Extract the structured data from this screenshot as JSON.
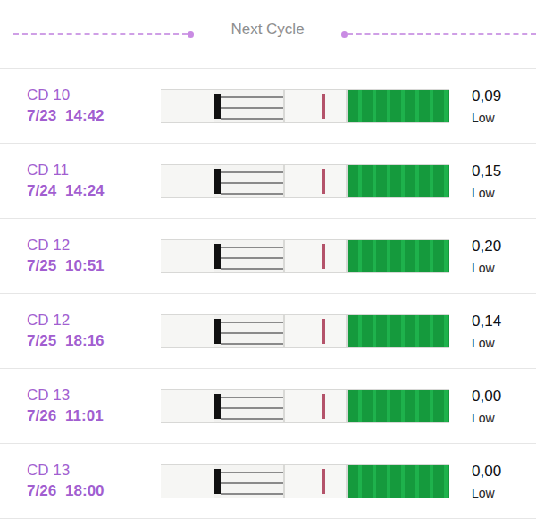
{
  "header": {
    "title": "Next Cycle"
  },
  "rows": [
    {
      "day": "CD 10",
      "date": "7/23",
      "time": "14:42",
      "value": "0,09",
      "result": "Low"
    },
    {
      "day": "CD 11",
      "date": "7/24",
      "time": "14:24",
      "value": "0,15",
      "result": "Low"
    },
    {
      "day": "CD 12",
      "date": "7/25",
      "time": "10:51",
      "value": "0,20",
      "result": "Low"
    },
    {
      "day": "CD 12",
      "date": "7/25",
      "time": "18:16",
      "value": "0,14",
      "result": "Low"
    },
    {
      "day": "CD 13",
      "date": "7/26",
      "time": "11:01",
      "value": "0,00",
      "result": "Low"
    },
    {
      "day": "CD 13",
      "date": "7/26",
      "time": "18:00",
      "value": "0,00",
      "result": "Low"
    }
  ]
}
